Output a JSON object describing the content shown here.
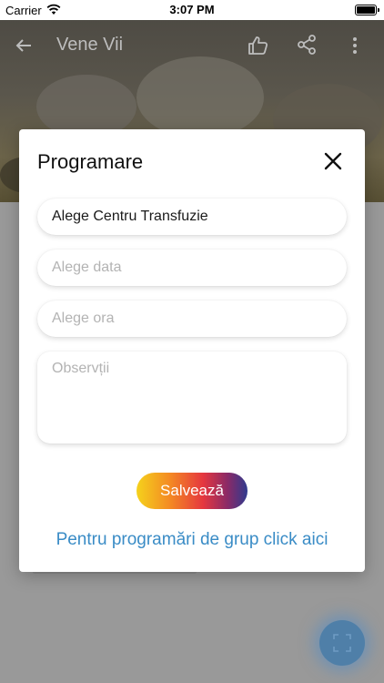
{
  "status_bar": {
    "carrier": "Carrier",
    "time": "3:07 PM"
  },
  "background_app": {
    "title": "Vene Vii",
    "icons": {
      "back": "arrow-back-icon",
      "like": "thumbs-up-icon",
      "share": "share-icon",
      "more": "more-vertical-icon",
      "fab": "expand-icon"
    }
  },
  "modal": {
    "title": "Programare",
    "close_icon": "close-icon",
    "center_field": {
      "value": "Alege Centru Transfuzie"
    },
    "date_field": {
      "placeholder": "Alege data"
    },
    "time_field": {
      "placeholder": "Alege ora"
    },
    "notes_field": {
      "placeholder": "Observții"
    },
    "save_label": "Salvează",
    "group_link": "Pentru programări de grup click aici"
  },
  "colors": {
    "link": "#3a8cc6",
    "gradient_start": "#f5d21c",
    "gradient_end": "#2f3a8e"
  }
}
